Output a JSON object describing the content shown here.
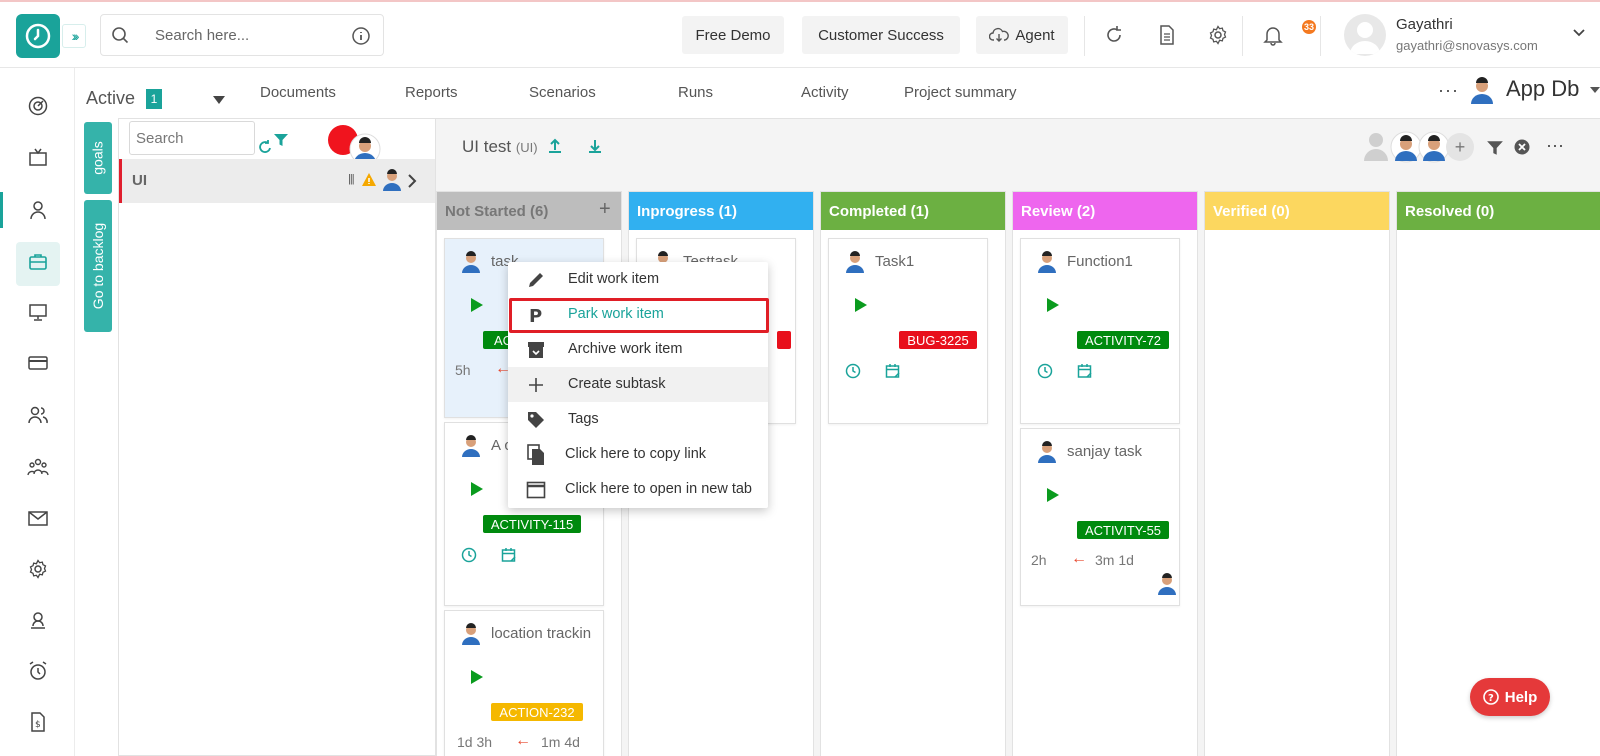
{
  "header": {
    "search_placeholder": "Search here...",
    "buttons": {
      "free_demo": "Free Demo",
      "customer_success": "Customer Success",
      "agent": "Agent"
    },
    "notification_count": "33",
    "user": {
      "name": "Gayathri",
      "email": "gayathri@snovasys.com"
    }
  },
  "nav": {
    "active_label": "Active",
    "active_count": "1",
    "tabs": [
      "Documents",
      "Reports",
      "Scenarios",
      "Runs",
      "Activity",
      "Project summary"
    ],
    "workspace": "App Db"
  },
  "side_tabs": {
    "goals": "goals",
    "backlog": "Go to backlog"
  },
  "goals_panel": {
    "search_placeholder": "Search",
    "goals": [
      {
        "name": "UI"
      }
    ]
  },
  "board": {
    "title": "UI test",
    "title_code": "(UI)",
    "columns": [
      {
        "name": "Not Started (6)",
        "color": "#bdbdbd"
      },
      {
        "name": "Inprogress (1)",
        "color": "#31b0f0"
      },
      {
        "name": "Completed (1)",
        "color": "#6cb042"
      },
      {
        "name": "Review (2)",
        "color": "#ee66ee"
      },
      {
        "name": "Verified (0)",
        "color": "#fcd75f"
      },
      {
        "name": "Resolved (0)",
        "color": "#6cb042"
      }
    ],
    "cards": {
      "task": {
        "title": "task",
        "tag": "AC",
        "estimate": "5h"
      },
      "a_card": {
        "title": "A c",
        "tag": "ACTIVITY-115"
      },
      "location": {
        "title": "location trackin",
        "tag": "ACTION-232",
        "estimate": "1d 3h",
        "spent": "1m 4d"
      },
      "testtask": {
        "title": "Testtask"
      },
      "task1": {
        "title": "Task1",
        "tag": "BUG-3225"
      },
      "function1": {
        "title": "Function1",
        "tag": "ACTIVITY-72"
      },
      "sanjay": {
        "title": "sanjay task",
        "tag": "ACTIVITY-55",
        "estimate": "2h",
        "spent": "3m 1d"
      }
    }
  },
  "context_menu": {
    "items": [
      {
        "label": "Edit work item",
        "icon": "pencil-icon"
      },
      {
        "label": "Park work item",
        "icon": "park-icon"
      },
      {
        "label": "Archive work item",
        "icon": "archive-icon"
      },
      {
        "label": "Create subtask",
        "icon": "plus-icon"
      },
      {
        "label": "Tags",
        "icon": "tag-icon"
      },
      {
        "label": "Click here to copy link",
        "icon": "copy-icon"
      },
      {
        "label": "Click here to open in new tab",
        "icon": "new-tab-icon"
      }
    ]
  },
  "help_label": "Help",
  "colors": {
    "teal": "#1aa39a",
    "red": "#e01e26",
    "green_tag": "#008a0e",
    "red_tag": "#e8101c",
    "amber_tag": "#f5b800"
  }
}
